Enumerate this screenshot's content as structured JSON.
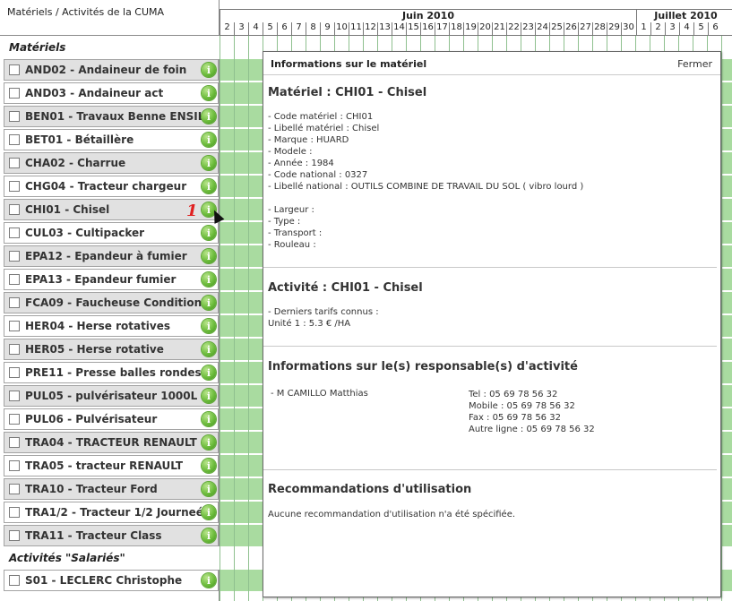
{
  "left_header": "Matériels / Activités de la CUMA",
  "section_materiels": "Matériels",
  "section_salaries": "Activités \"Salariés\"",
  "materiels": [
    "AND02 - Andaineur de foin",
    "AND03 - Andaineur act",
    "BEN01 - Travaux Benne ENSILAGE",
    "BET01 - Bétaillère",
    "CHA02 - Charrue",
    "CHG04 - Tracteur chargeur",
    "CHI01 - Chisel",
    "CUL03 - Cultipacker",
    "EPA12 - Epandeur à fumier",
    "EPA13 - Epandeur fumier",
    "FCA09 - Faucheuse Conditionneuse",
    "HER04 - Herse rotatives",
    "HER05 - Herse rotative",
    "PRE11 - Presse balles rondes",
    "PUL05 - pulvérisateur 1000L",
    "PUL06 - Pulvérisateur",
    "TRA04 - TRACTEUR RENAULT",
    "TRA05 - tracteur RENAULT",
    "TRA10 - Tracteur Ford",
    "TRA1/2 - Tracteur 1/2 Journeé",
    "TRA11 - Tracteur Class"
  ],
  "salaries": [
    "S01 - LECLERC Christophe"
  ],
  "info_icon_glyph": "i",
  "calendar": {
    "month1": "Juin 2010",
    "month2": "Juillet 2010",
    "june_days": [
      "2",
      "3",
      "4",
      "5",
      "6",
      "7",
      "8",
      "9",
      "10",
      "11",
      "12",
      "13",
      "14",
      "15",
      "16",
      "17",
      "18",
      "19",
      "20",
      "21",
      "22",
      "23",
      "24",
      "25",
      "26",
      "27",
      "28",
      "29",
      "30"
    ],
    "july_days": [
      "1",
      "2",
      "3",
      "4",
      "5",
      "6"
    ],
    "fill_color": "#a9dba0"
  },
  "popup": {
    "title": "Informations sur le matériel",
    "close": "Fermer",
    "mat_heading": "Matériel : CHI01 - Chisel",
    "mat_lines": [
      "- Code matériel : CHI01",
      "- Libellé matériel : Chisel",
      "- Marque : HUARD",
      "- Modele :",
      "- Année : 1984",
      "- Code national : 0327",
      "- Libellé national : OUTILS COMBINE DE TRAVAIL DU SOL ( vibro lourd )"
    ],
    "dim_lines": [
      "- Largeur :",
      "- Type :",
      "- Transport :",
      "- Rouleau :"
    ],
    "act_heading": "Activité : CHI01 - Chisel",
    "act_lines": [
      "- Derniers tarifs connus :",
      "Unité 1 : 5.3 € /HA"
    ],
    "resp_heading": "Informations sur le(s) responsable(s) d'activité",
    "resp_name": "- M CAMILLO Matthias",
    "resp_contacts": [
      "Tel : 05 69 78 56 32",
      "Mobile : 05 69 78 56 32",
      "Fax : 05 69 78 56 32",
      "Autre ligne : 05 69 78 56 32"
    ],
    "reco_heading": "Recommandations d'utilisation",
    "reco_text": "Aucune recommandation d'utilisation n'a été spécifiée."
  },
  "annotation_marker": "1"
}
